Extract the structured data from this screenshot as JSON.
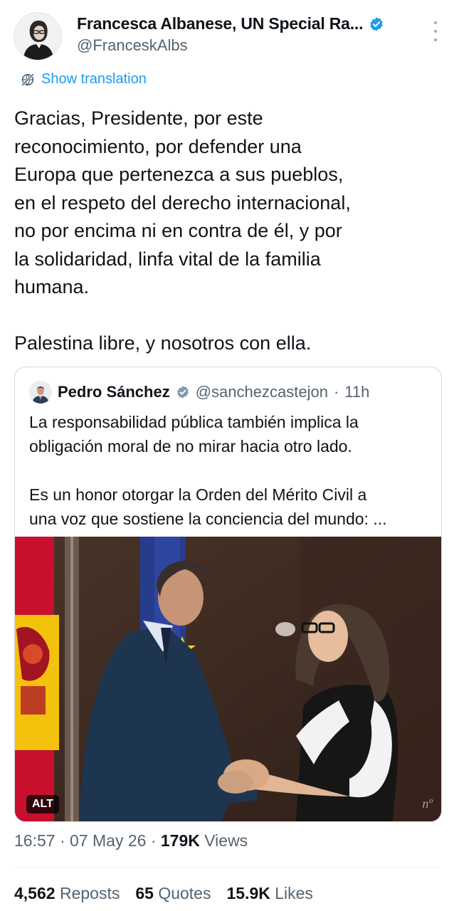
{
  "author": {
    "display_name": "Francesca Albanese, UN Special Ra...",
    "handle": "@FranceskAlbs",
    "verified": true
  },
  "translate": {
    "label": "Show translation",
    "icon": "globe-slash-icon"
  },
  "tweet": {
    "paragraph1": [
      "Gracias, Presidente, por este",
      "reconocimiento, por defender una",
      "Europa que pertenezca a sus pueblos,",
      "en el respeto del derecho internacional,",
      "no por encima ni en contra de él, y por",
      "la solidaridad, linfa vital de la familia",
      "humana."
    ],
    "paragraph2": "Palestina libre, y nosotros con ella."
  },
  "quote": {
    "name": "Pedro Sánchez",
    "verified": true,
    "verified_color": "#829aab",
    "handle": "@sanchezcastejon",
    "separator": "·",
    "time": "11h",
    "paragraph1": [
      "La responsabilidad pública también implica la",
      "obligación moral de no mirar hacia otro lado."
    ],
    "paragraph2": [
      "Es un honor otorgar la Orden del Mérito Civil a",
      "una voz que sostiene la conciencia del mundo: ..."
    ],
    "media_alt_badge": "ALT",
    "media_watermark": "nº"
  },
  "meta": {
    "time": "16:57",
    "sep1": "·",
    "date": "07 May 26",
    "sep2": "·",
    "views_count": "179K",
    "views_label": "Views"
  },
  "stats": {
    "reposts_count": "4,562",
    "reposts_label": "Reposts",
    "quotes_count": "65",
    "quotes_label": "Quotes",
    "likes_count": "15.9K",
    "likes_label": "Likes"
  },
  "colors": {
    "accent": "#1d9bf0",
    "secondary_text": "#536471",
    "primary_text": "#0f1419"
  }
}
